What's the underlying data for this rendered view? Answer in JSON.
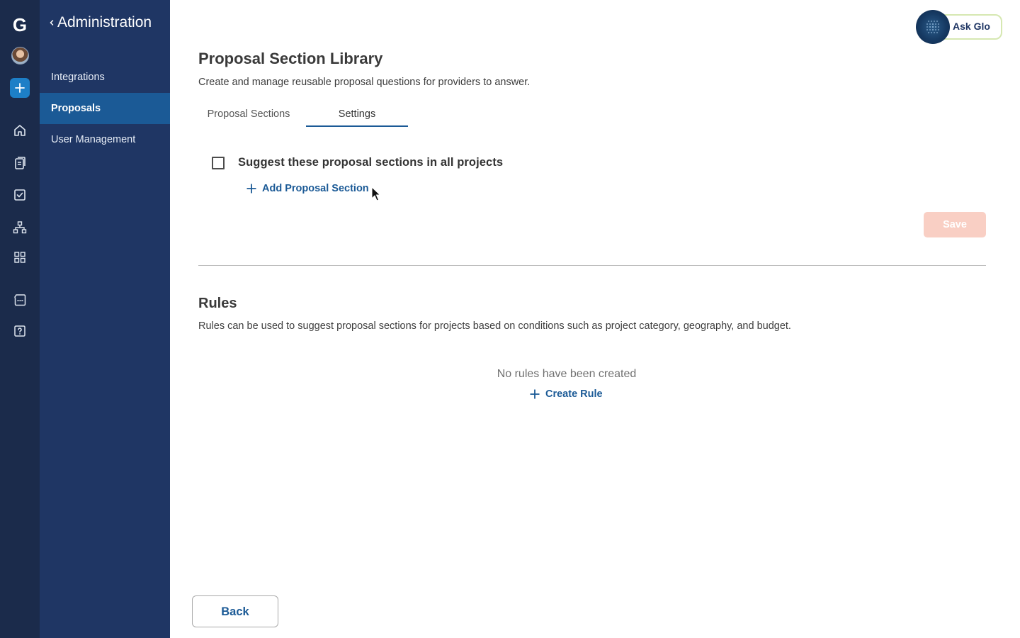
{
  "rail": {
    "logo": "G",
    "icons": [
      "avatar",
      "add-icon",
      "home-icon",
      "documents-icon",
      "checklist-icon",
      "org-chart-icon",
      "apps-grid-icon",
      "chat-icon",
      "help-icon"
    ]
  },
  "sidebar": {
    "title": "Administration",
    "items": [
      {
        "label": "Integrations",
        "active": false
      },
      {
        "label": "Proposals",
        "active": true
      },
      {
        "label": "User Management",
        "active": false
      }
    ]
  },
  "assistant": {
    "label": "Ask Glo"
  },
  "page": {
    "title": "Proposal Section Library",
    "subtitle": "Create and manage reusable proposal questions for providers to answer.",
    "tabs": [
      {
        "label": "Proposal Sections",
        "active": false
      },
      {
        "label": "Settings",
        "active": true
      }
    ]
  },
  "settings": {
    "suggest_label": "Suggest these proposal sections in all projects",
    "suggest_checked": false,
    "add_section_label": "Add Proposal Section",
    "save_label": "Save"
  },
  "rules": {
    "title": "Rules",
    "description": "Rules can be used to suggest proposal sections for projects based on conditions such as project category, geography, and budget.",
    "empty_text": "No rules have been created",
    "create_label": "Create Rule"
  },
  "footer": {
    "back_label": "Back"
  },
  "colors": {
    "rail_bg": "#1b2b4b",
    "sidebar_bg": "#1f3664",
    "sidebar_active": "#1b5a96",
    "link": "#1b5a96",
    "save_disabled": "#f9cfc4",
    "plus_button": "#1d7fc7"
  }
}
